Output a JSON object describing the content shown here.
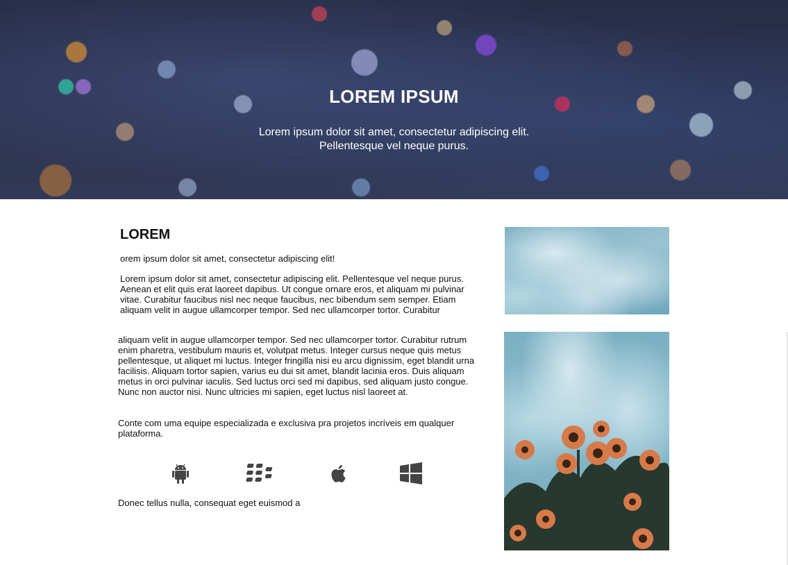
{
  "hero": {
    "title": "LOREM IPSUM",
    "subtitle_line1": "Lorem ipsum dolor sit amet, consectetur adipiscing elit.",
    "subtitle_line2": "Pellentesque vel neque purus."
  },
  "main": {
    "heading": "LOREM",
    "lead": "orem ipsum dolor sit amet, consectetur adipiscing elit!",
    "paragraph1": "Lorem ipsum dolor sit amet, consectetur adipiscing elit. Pellentesque vel neque purus. Aenean et elit quis erat laoreet dapibus. Ut congue ornare eros, et aliquam mi pulvinar vitae. Curabitur faucibus nisl nec neque faucibus, nec bibendum sem semper. Etiam aliquam velit in augue ullamcorper tempor. Sed nec ullamcorper tortor. Curabitur",
    "paragraph2": "aliquam velit in augue ullamcorper tempor. Sed nec ullamcorper tortor. Curabitur rutrum enim pharetra, vestibulum mauris et, volutpat metus. Integer cursus neque quis metus pellentesque, ut aliquet mi luctus. Integer fringilla nisi eu arcu dignissim, eget blandit urna facilisis. Aliquam tortor sapien, varius eu dui sit amet, blandit lacinia eros. Duis aliquam metus in orci pulvinar iaculis. Sed luctus orci sed mi dapibus, sed aliquam justo congue. Nunc non auctor nisi. Nunc ultricies mi sapien, eget luctus nisl laoreet at.",
    "paragraph3": "Conte com uma equipe especializada e exclusiva pra projetos incríveis em qualquer plataforma.",
    "footer_text": "Donec tellus nulla, consequat eget euismod a"
  },
  "platform_icons": [
    "android-icon",
    "blackberry-icon",
    "apple-icon",
    "windows-icon"
  ],
  "colors": {
    "icon": "#444444",
    "text": "#111111",
    "hero_text": "#ffffff"
  }
}
